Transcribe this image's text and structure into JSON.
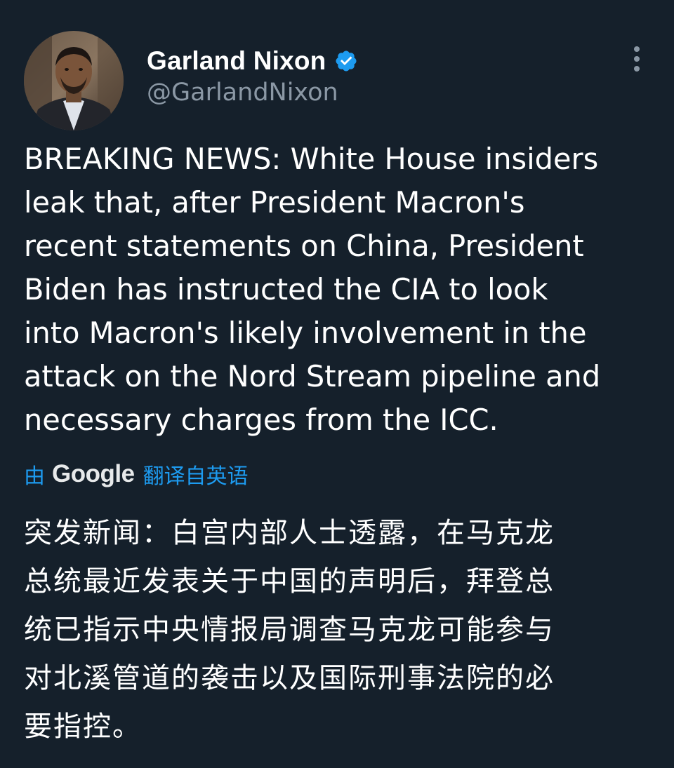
{
  "tweet": {
    "author": {
      "display_name": "Garland Nixon",
      "handle": "@GarlandNixon",
      "verified": true,
      "avatar_icon": "profile-photo"
    },
    "menu_icon": "more-vertical-icon",
    "text_lines": [
      "BREAKING NEWS: White House insiders",
      "leak that, after President Macron's",
      "recent statements on China, President",
      "Biden has instructed the CIA to look",
      "into Macron's likely involvement in the",
      "attack on the Nord Stream pipeline and",
      "necessary charges from the ICC."
    ],
    "translation": {
      "prefix": "由",
      "brand": "Google",
      "suffix": "翻译自英语",
      "lines": [
        "突发新闻：白宫内部人士透露，在马克龙",
        "总统最近发表关于中国的声明后，拜登总",
        "统已指示中央情报局调查马克龙可能参与",
        "对北溪管道的袭击以及国际刑事法院的必",
        "要指控。"
      ]
    }
  },
  "colors": {
    "background": "#15202b",
    "primary_text": "#ffffff",
    "secondary_text": "#8b98a5",
    "accent": "#1d9bf0"
  }
}
